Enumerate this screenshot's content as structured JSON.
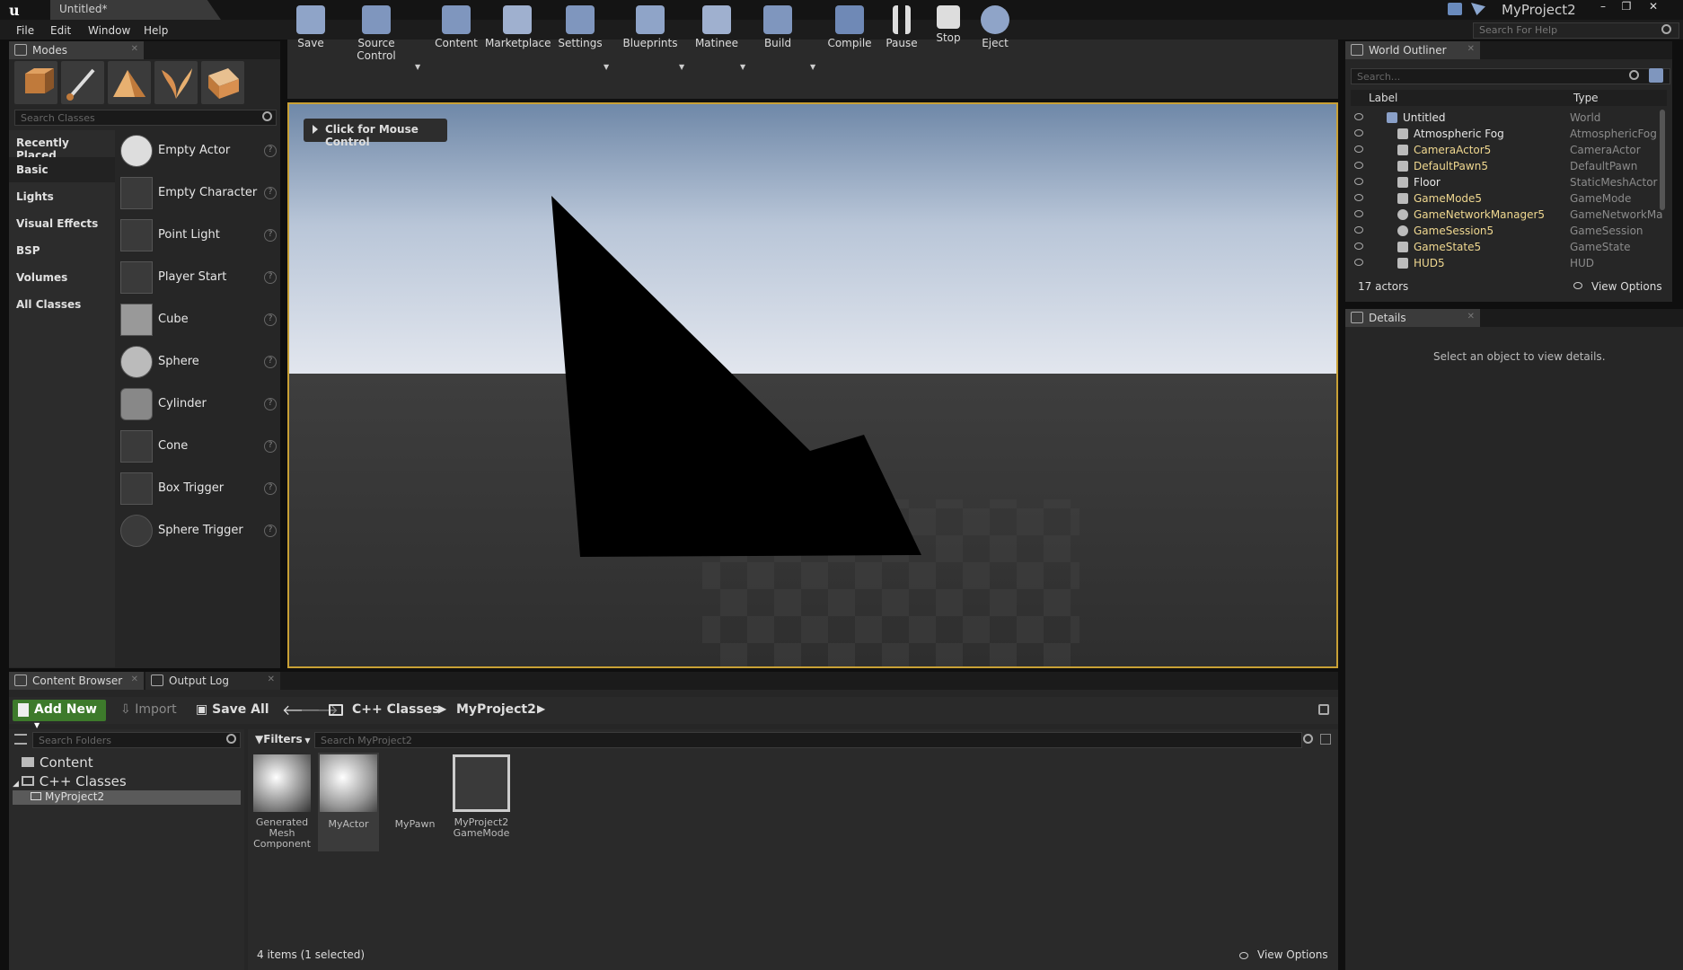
{
  "window": {
    "doc_tab": "Untitled*",
    "project": "MyProject2",
    "minimize": "–",
    "maximize": "❐",
    "close": "✕"
  },
  "menu": [
    "File",
    "Edit",
    "Window",
    "Help"
  ],
  "help_search_placeholder": "Search For Help",
  "modes": {
    "tab_label": "Modes",
    "search_placeholder": "Search Classes",
    "categories": [
      "Recently Placed",
      "Basic",
      "Lights",
      "Visual Effects",
      "BSP",
      "Volumes",
      "All Classes"
    ],
    "selected_category": "Basic",
    "items": [
      "Empty Actor",
      "Empty Character",
      "Point Light",
      "Player Start",
      "Cube",
      "Sphere",
      "Cylinder",
      "Cone",
      "Box Trigger",
      "Sphere Trigger"
    ],
    "help_glyph": "?"
  },
  "toolbar": {
    "buttons": [
      "Save",
      "Source Control",
      "Content",
      "Marketplace",
      "Settings",
      "Blueprints",
      "Matinee",
      "Build",
      "Compile",
      "Pause",
      "Stop",
      "Eject"
    ],
    "dropdown_caret": "▼"
  },
  "viewport": {
    "mouse_control": "Click for Mouse Control"
  },
  "outliner": {
    "tab_label": "World Outliner",
    "search_placeholder": "Search...",
    "col_label": "Label",
    "col_type": "Type",
    "rows": [
      {
        "label": "Untitled",
        "type": "World"
      },
      {
        "label": "Atmospheric Fog",
        "type": "AtmosphericFog"
      },
      {
        "label": "CameraActor5",
        "type": "CameraActor"
      },
      {
        "label": "DefaultPawn5",
        "type": "DefaultPawn"
      },
      {
        "label": "Floor",
        "type": "StaticMeshActor"
      },
      {
        "label": "GameMode5",
        "type": "GameMode"
      },
      {
        "label": "GameNetworkManager5",
        "type": "GameNetworkMa"
      },
      {
        "label": "GameSession5",
        "type": "GameSession"
      },
      {
        "label": "GameState5",
        "type": "GameState"
      },
      {
        "label": "HUD5",
        "type": "HUD"
      }
    ],
    "count": "17 actors",
    "view_options": "View Options"
  },
  "details": {
    "tab_label": "Details",
    "empty": "Select an object to view details."
  },
  "content_browser": {
    "tab_label": "Content Browser",
    "output_log": "Output Log",
    "add_new": "Add New",
    "import": "Import",
    "save_all": "Save All",
    "path": [
      "C++ Classes",
      "MyProject2"
    ],
    "folder_search_placeholder": "Search Folders",
    "tree": [
      "Content",
      "C++ Classes",
      "MyProject2"
    ],
    "filters": "Filters",
    "asset_search_placeholder": "Search MyProject2",
    "assets": [
      "Generated Mesh Component",
      "MyActor",
      "MyPawn",
      "MyProject2 GameMode"
    ],
    "selected_asset": "MyActor",
    "status": "4 items (1 selected)",
    "view_options": "View Options"
  }
}
